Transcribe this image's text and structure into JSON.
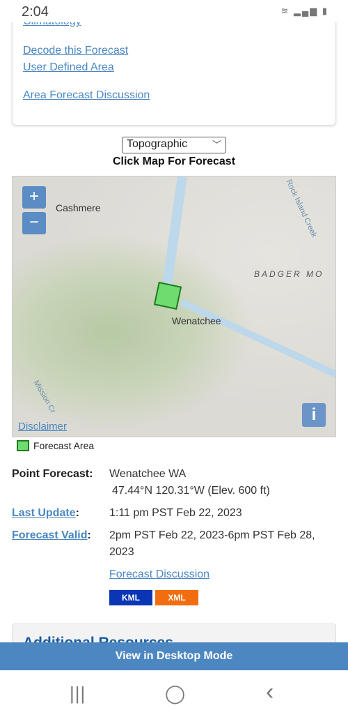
{
  "status_bar": {
    "time": "2:04",
    "icons": [
      "wifi-icon",
      "signal-icon",
      "battery-icon"
    ]
  },
  "links": {
    "climatology": "Climatology",
    "decode": "Decode this Forecast",
    "user_area": "User Defined Area",
    "afd": "Area Forecast Discussion"
  },
  "map_select": {
    "value": "Topographic"
  },
  "click_map": "Click Map For Forecast",
  "map": {
    "labels": {
      "cashmere": "Cashmere",
      "wenatchee": "Wenatchee",
      "badger": "BADGER MO",
      "rock_island": "Rock Island Creek",
      "mission": "Mission Cr"
    },
    "zoom_in": "+",
    "zoom_out": "−",
    "info": "i",
    "disclaimer": "Disclaimer",
    "forecast_area_color": "#6fdc6f"
  },
  "legend": {
    "label": "Forecast Area"
  },
  "details": {
    "point_label": "Point Forecast:",
    "point_name": "Wenatchee WA",
    "point_coords": "47.44°N 120.31°W (Elev. 600 ft)",
    "last_update_label": "Last Update",
    "last_update": "1:11 pm PST Feb 22, 2023",
    "valid_label": "Forecast Valid",
    "valid": "2pm PST Feb 22, 2023-6pm PST Feb 28, 2023",
    "discussion": "Forecast Discussion",
    "kml": "KML",
    "xml": "XML",
    "colon": ":"
  },
  "additional_resources": "Additional Resources",
  "desktop_mode": "View in Desktop Mode",
  "nav": {
    "recents": "|||",
    "home": "◯",
    "back": "‹"
  }
}
